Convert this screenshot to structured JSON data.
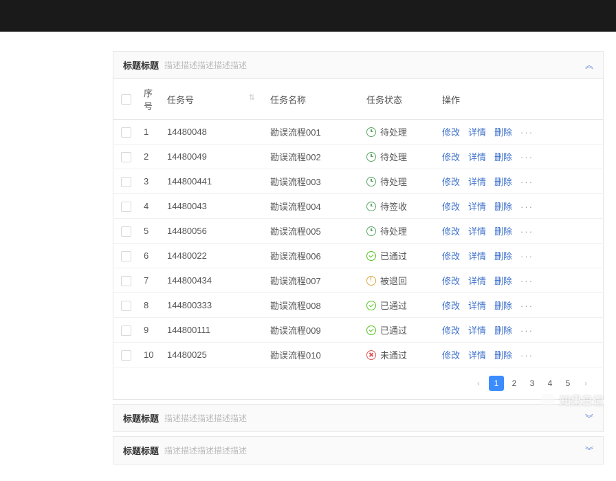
{
  "panel": {
    "title": "标题标题",
    "desc": "描述描述描述描述描述"
  },
  "columns": {
    "seq": "序号",
    "task": "任务号",
    "name": "任务名称",
    "status": "任务状态",
    "ops": "操作"
  },
  "rows": [
    {
      "seq": "1",
      "task": "14480048",
      "name": "勘误流程001",
      "status": "待处理",
      "icon": "clock"
    },
    {
      "seq": "2",
      "task": "14480049",
      "name": "勘误流程002",
      "status": "待处理",
      "icon": "clock"
    },
    {
      "seq": "3",
      "task": "144800441",
      "name": "勘误流程003",
      "status": "待处理",
      "icon": "clock"
    },
    {
      "seq": "4",
      "task": "14480043",
      "name": "勘误流程004",
      "status": "待签收",
      "icon": "clock"
    },
    {
      "seq": "5",
      "task": "14480056",
      "name": "勘误流程005",
      "status": "待处理",
      "icon": "clock"
    },
    {
      "seq": "6",
      "task": "14480022",
      "name": "勘误流程006",
      "status": "已通过",
      "icon": "check"
    },
    {
      "seq": "7",
      "task": "144800434",
      "name": "勘误流程007",
      "status": "被退回",
      "icon": "warn"
    },
    {
      "seq": "8",
      "task": "144800333",
      "name": "勘误流程008",
      "status": "已通过",
      "icon": "check"
    },
    {
      "seq": "9",
      "task": "144800111",
      "name": "勘误流程009",
      "status": "已通过",
      "icon": "check"
    },
    {
      "seq": "10",
      "task": "14480025",
      "name": "勘误流程010",
      "status": "未通过",
      "icon": "fail"
    }
  ],
  "actions": {
    "edit": "修改",
    "detail": "详情",
    "delete": "删除"
  },
  "pagination": {
    "pages": [
      "1",
      "2",
      "3",
      "4",
      "5"
    ],
    "active": "1"
  },
  "watermark": "知果日记"
}
